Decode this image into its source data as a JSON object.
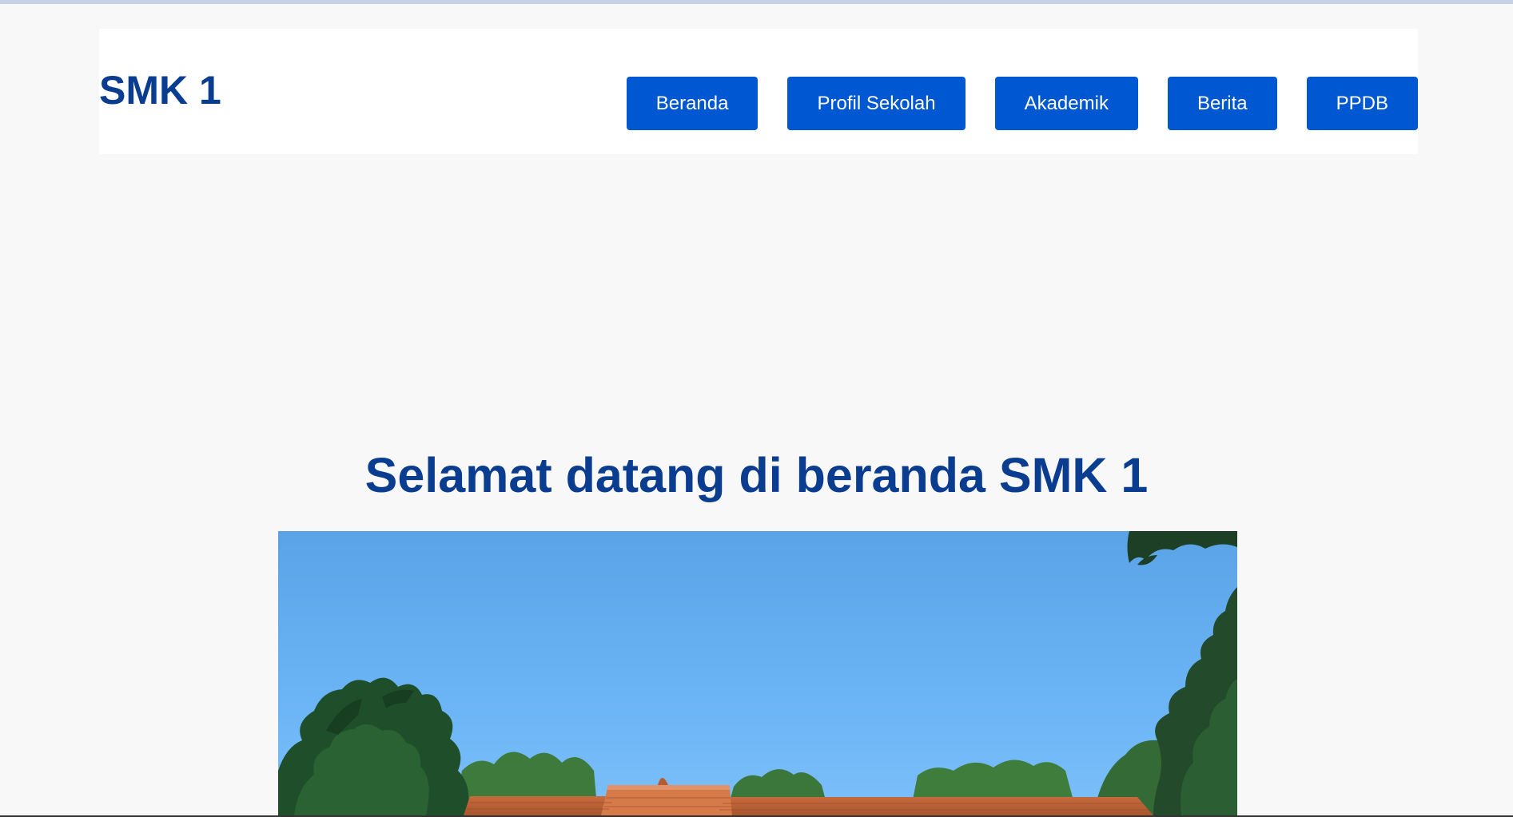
{
  "header": {
    "site_title": "SMK 1",
    "nav": [
      {
        "label": "Beranda"
      },
      {
        "label": "Profil Sekolah"
      },
      {
        "label": "Akademik"
      },
      {
        "label": "Berita"
      },
      {
        "label": "PPDB"
      }
    ]
  },
  "main": {
    "welcome_heading": "Selamat datang di beranda SMK 1"
  },
  "colors": {
    "brand_dark": "#0a3d8f",
    "nav_button": "#0057d2",
    "page_background": "#f8f8f8"
  }
}
